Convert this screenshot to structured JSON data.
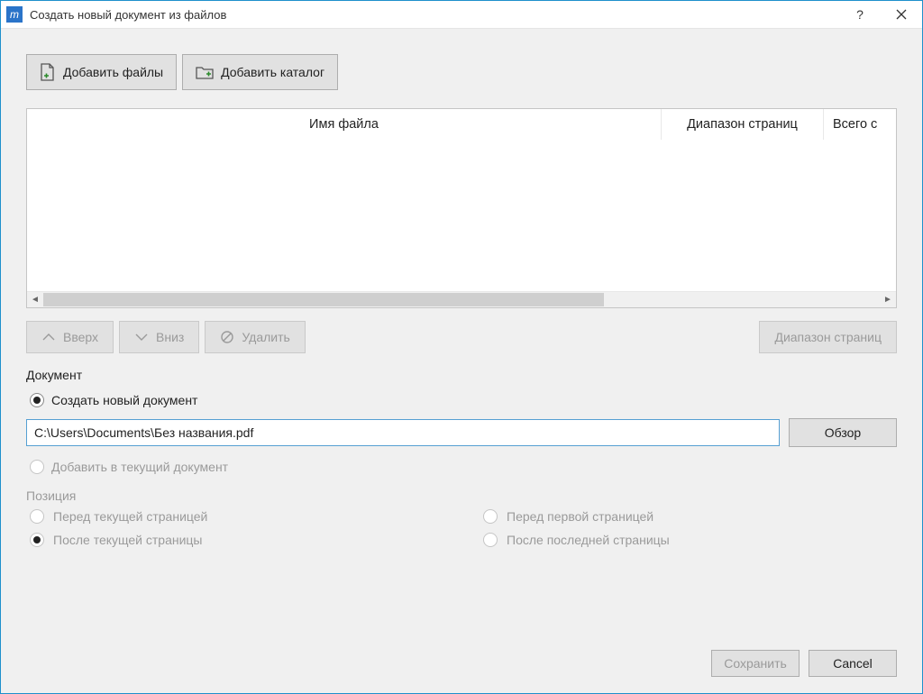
{
  "window": {
    "title": "Создать новый документ из файлов"
  },
  "toolbar": {
    "add_files": "Добавить файлы",
    "add_folder": "Добавить каталог"
  },
  "columns": {
    "name": "Имя файла",
    "range": "Диапазон страниц",
    "total": "Всего с"
  },
  "actions": {
    "up": "Вверх",
    "down": "Вниз",
    "delete": "Удалить",
    "page_range": "Диапазон страниц"
  },
  "document": {
    "section_label": "Документ",
    "create_new": "Создать новый документ",
    "path_value": "C:\\Users\\Documents\\Без названия.pdf",
    "browse": "Обзор",
    "add_current": "Добавить в текущий документ"
  },
  "position": {
    "label": "Позиция",
    "before_current": "Перед текущей страницей",
    "after_current": "После текущей страницы",
    "before_first": "Перед первой страницей",
    "after_last": "После последней страницы"
  },
  "footer": {
    "save": "Сохранить",
    "cancel": "Cancel"
  }
}
